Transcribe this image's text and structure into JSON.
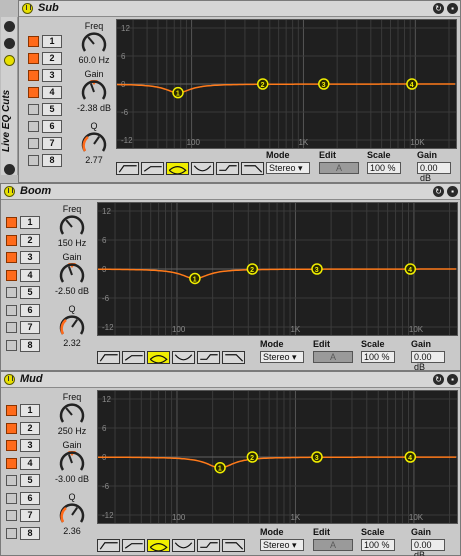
{
  "rack": {
    "name": "Live EQ Cuts"
  },
  "devices": [
    {
      "title": "Sub",
      "bands": [
        {
          "label": "1",
          "on": true
        },
        {
          "label": "2",
          "on": true
        },
        {
          "label": "3",
          "on": true
        },
        {
          "label": "4",
          "on": true
        },
        {
          "label": "5",
          "on": false
        },
        {
          "label": "6",
          "on": false
        },
        {
          "label": "7",
          "on": false
        },
        {
          "label": "8",
          "on": false
        }
      ],
      "freq_label": "Freq",
      "freq_value": "60.0 Hz",
      "gain_label": "Gain",
      "gain_value": "-2.38 dB",
      "q_label": "Q",
      "q_value": "2.77",
      "y_ticks": [
        "12",
        "6",
        "0",
        "-6",
        "-12"
      ],
      "x_ticks": [
        "100",
        "1K",
        "10K"
      ],
      "mode_label": "Mode",
      "mode_value": "Stereo",
      "edit_label": "Edit",
      "edit_value": "A",
      "scale_label": "Scale",
      "scale_value": "100 %",
      "gain_out_label": "Gain",
      "gain_out_value": "0.00 dB"
    },
    {
      "title": "Boom",
      "bands": [
        {
          "label": "1",
          "on": true
        },
        {
          "label": "2",
          "on": true
        },
        {
          "label": "3",
          "on": true
        },
        {
          "label": "4",
          "on": true
        },
        {
          "label": "5",
          "on": false
        },
        {
          "label": "6",
          "on": false
        },
        {
          "label": "7",
          "on": false
        },
        {
          "label": "8",
          "on": false
        }
      ],
      "freq_label": "Freq",
      "freq_value": "150 Hz",
      "gain_label": "Gain",
      "gain_value": "-2.50 dB",
      "q_label": "Q",
      "q_value": "2.32",
      "y_ticks": [
        "12",
        "6",
        "0",
        "-6",
        "-12"
      ],
      "x_ticks": [
        "100",
        "1K",
        "10K"
      ],
      "mode_label": "Mode",
      "mode_value": "Stereo",
      "edit_label": "Edit",
      "edit_value": "A",
      "scale_label": "Scale",
      "scale_value": "100 %",
      "gain_out_label": "Gain",
      "gain_out_value": "0.00 dB"
    },
    {
      "title": "Mud",
      "bands": [
        {
          "label": "1",
          "on": true
        },
        {
          "label": "2",
          "on": true
        },
        {
          "label": "3",
          "on": true
        },
        {
          "label": "4",
          "on": true
        },
        {
          "label": "5",
          "on": false
        },
        {
          "label": "6",
          "on": false
        },
        {
          "label": "7",
          "on": false
        },
        {
          "label": "8",
          "on": false
        }
      ],
      "freq_label": "Freq",
      "freq_value": "250 Hz",
      "gain_label": "Gain",
      "gain_value": "-3.00 dB",
      "q_label": "Q",
      "q_value": "2.36",
      "y_ticks": [
        "12",
        "6",
        "0",
        "-6",
        "-12"
      ],
      "x_ticks": [
        "100",
        "1K",
        "10K"
      ],
      "mode_label": "Mode",
      "mode_value": "Stereo",
      "edit_label": "Edit",
      "edit_value": "A",
      "scale_label": "Scale",
      "scale_value": "100 %",
      "gain_out_label": "Gain",
      "gain_out_value": "0.00 dB"
    }
  ],
  "colors": {
    "band_on": "#ff6a1a",
    "curve": "#ff7a1a",
    "marker": "#f0ee00",
    "graph_bg": "#1f1f1f"
  }
}
